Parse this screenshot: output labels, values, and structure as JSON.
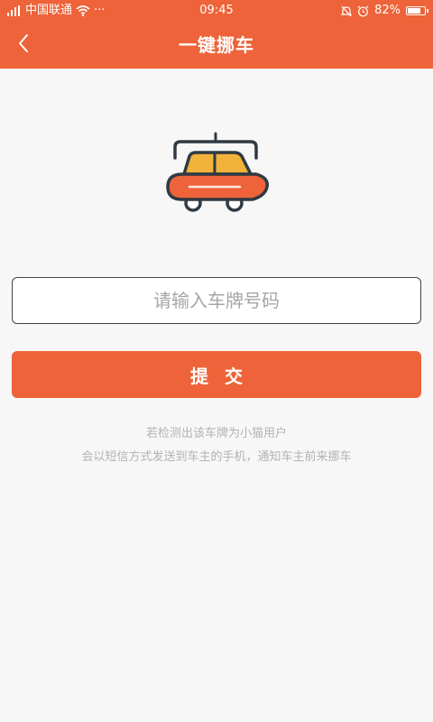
{
  "status_bar": {
    "carrier": "中国联通",
    "more": "···",
    "time": "09:45",
    "battery_percent": "82%",
    "battery_level": 0.82
  },
  "app_bar": {
    "title": "一键挪车"
  },
  "form": {
    "plate_placeholder": "请输入车牌号码",
    "plate_value": "",
    "submit_label": "提交"
  },
  "info": {
    "line1": "若检测出该车牌为小猫用户",
    "line2": "会以短信方式发送到车主的手机，通知车主前来挪车"
  },
  "colors": {
    "accent": "#ee6339",
    "car_window": "#f2b33a",
    "car_outline": "#2f3a44",
    "hint_text": "#b3b3b3"
  }
}
